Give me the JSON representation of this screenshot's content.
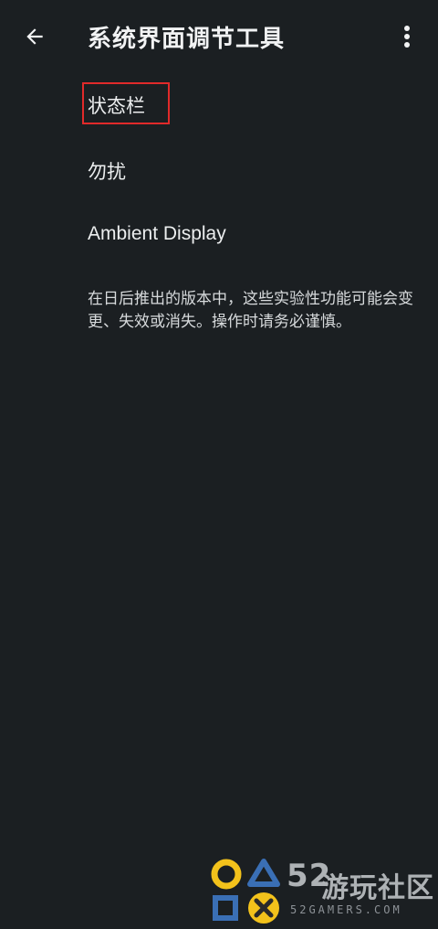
{
  "header": {
    "title": "系统界面调节工具",
    "back_icon": "arrow-back-icon",
    "more_icon": "more-vert-icon"
  },
  "menu": {
    "items": [
      {
        "label": "状态栏",
        "highlighted": true
      },
      {
        "label": "勿扰",
        "highlighted": false
      },
      {
        "label": "Ambient Display",
        "highlighted": false
      }
    ]
  },
  "note": {
    "text": "在日后推出的版本中，这些实验性功能可能会变更、失效或消失。操作时请务必谨慎。"
  },
  "watermark": {
    "number": "52",
    "name": "游玩社区",
    "url": "52GAMERS.COM"
  },
  "colors": {
    "background": "#1b1f22",
    "text": "#eceeef",
    "highlight_border": "#e12a2a",
    "watermark_yellow": "#f3c21b",
    "watermark_blue": "#3a6fb5"
  }
}
